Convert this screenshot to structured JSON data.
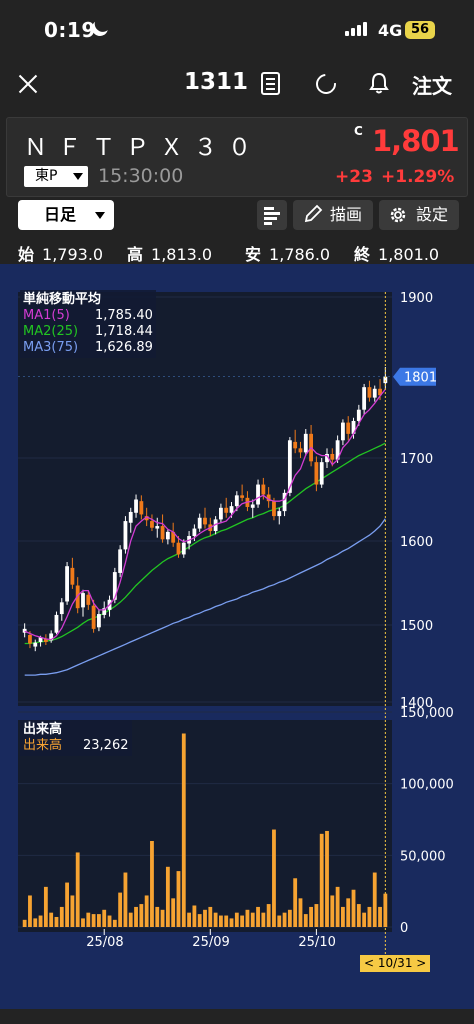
{
  "status": {
    "time": "0:19",
    "network": "4G",
    "battery": "56"
  },
  "nav": {
    "code": "1311",
    "order_label": "注文"
  },
  "stock": {
    "name": "ＮＦＴＰＸ３０",
    "market": "東P",
    "time": "15:30:00",
    "price_flag": "C",
    "price": "1,801",
    "change": "+23",
    "change_pct": "+1.29%"
  },
  "toolbar": {
    "period": "日足",
    "draw_label": "描画",
    "settings_label": "設定"
  },
  "ohlc": {
    "open_label": "始",
    "open": "1,793.0",
    "high_label": "高",
    "high": "1,813.0",
    "low_label": "安",
    "low": "1,786.0",
    "close_label": "終",
    "close": "1,801.0"
  },
  "ma_legend": {
    "title": "単純移動平均",
    "ma1_label": "MA1(5)",
    "ma1_value": "1,785.40",
    "ma2_label": "MA2(25)",
    "ma2_value": "1,718.44",
    "ma3_label": "MA3(75)",
    "ma3_value": "1,626.89"
  },
  "volume_legend": {
    "title": "出来高",
    "label": "出来高",
    "value": "23,262"
  },
  "cursor_date": "< 10/31 >",
  "colors": {
    "up": "#ffffff",
    "down": "#f07a1a",
    "ma1": "#d23cd2",
    "ma2": "#22c522",
    "ma3": "#7a9ef0",
    "volume": "#f6a332",
    "price_red": "#ff3b3b",
    "chart_bg": "#192a5e"
  },
  "chart_data": [
    {
      "type": "candlestick",
      "title": "",
      "x_ticks": [
        "25/08",
        "25/09",
        "25/10"
      ],
      "y_ticks": [
        1400,
        1500,
        1600,
        1700,
        1900
      ],
      "ylim": [
        1380,
        1910
      ],
      "last_price_label": "1801",
      "ma1_close": 1785.4,
      "ma2_close": 1718.44,
      "ma3_close": 1626.89,
      "candles": [
        [
          1490,
          1502,
          1484,
          1495
        ],
        [
          1487,
          1492,
          1470,
          1476
        ],
        [
          1472,
          1481,
          1466,
          1477
        ],
        [
          1478,
          1486,
          1472,
          1484
        ],
        [
          1482,
          1488,
          1474,
          1478
        ],
        [
          1480,
          1493,
          1477,
          1489
        ],
        [
          1490,
          1516,
          1488,
          1512
        ],
        [
          1513,
          1532,
          1505,
          1527
        ],
        [
          1528,
          1575,
          1524,
          1570
        ],
        [
          1568,
          1580,
          1543,
          1548
        ],
        [
          1547,
          1557,
          1514,
          1520
        ],
        [
          1521,
          1542,
          1510,
          1538
        ],
        [
          1536,
          1540,
          1518,
          1524
        ],
        [
          1523,
          1530,
          1490,
          1495
        ],
        [
          1497,
          1518,
          1492,
          1513
        ],
        [
          1512,
          1528,
          1508,
          1520
        ],
        [
          1518,
          1535,
          1510,
          1530
        ],
        [
          1530,
          1568,
          1526,
          1563
        ],
        [
          1562,
          1595,
          1557,
          1590
        ],
        [
          1590,
          1630,
          1585,
          1624
        ],
        [
          1622,
          1640,
          1610,
          1635
        ],
        [
          1634,
          1656,
          1628,
          1650
        ],
        [
          1648,
          1655,
          1626,
          1632
        ],
        [
          1630,
          1640,
          1618,
          1625
        ],
        [
          1624,
          1632,
          1612,
          1616
        ],
        [
          1615,
          1628,
          1604,
          1618
        ],
        [
          1618,
          1632,
          1598,
          1602
        ],
        [
          1602,
          1614,
          1596,
          1611
        ],
        [
          1611,
          1622,
          1593,
          1598
        ],
        [
          1598,
          1606,
          1580,
          1584
        ],
        [
          1584,
          1602,
          1580,
          1598
        ],
        [
          1597,
          1612,
          1590,
          1606
        ],
        [
          1606,
          1620,
          1600,
          1615
        ],
        [
          1615,
          1633,
          1611,
          1628
        ],
        [
          1628,
          1640,
          1615,
          1620
        ],
        [
          1620,
          1628,
          1606,
          1612
        ],
        [
          1612,
          1630,
          1608,
          1626
        ],
        [
          1626,
          1645,
          1622,
          1640
        ],
        [
          1640,
          1652,
          1628,
          1634
        ],
        [
          1634,
          1647,
          1628,
          1642
        ],
        [
          1642,
          1660,
          1636,
          1655
        ],
        [
          1655,
          1668,
          1648,
          1652
        ],
        [
          1652,
          1660,
          1636,
          1641
        ],
        [
          1640,
          1650,
          1628,
          1644
        ],
        [
          1644,
          1674,
          1640,
          1668
        ],
        [
          1668,
          1676,
          1650,
          1656
        ],
        [
          1656,
          1665,
          1640,
          1648
        ],
        [
          1648,
          1652,
          1625,
          1630
        ],
        [
          1630,
          1640,
          1620,
          1636
        ],
        [
          1636,
          1662,
          1630,
          1658
        ],
        [
          1658,
          1726,
          1654,
          1722
        ],
        [
          1720,
          1735,
          1706,
          1712
        ],
        [
          1712,
          1720,
          1700,
          1707
        ],
        [
          1707,
          1736,
          1703,
          1730
        ],
        [
          1730,
          1741,
          1690,
          1696
        ],
        [
          1695,
          1702,
          1660,
          1668
        ],
        [
          1668,
          1700,
          1664,
          1695
        ],
        [
          1695,
          1712,
          1688,
          1705
        ],
        [
          1705,
          1712,
          1690,
          1698
        ],
        [
          1698,
          1728,
          1694,
          1722
        ],
        [
          1722,
          1748,
          1716,
          1744
        ],
        [
          1744,
          1752,
          1722,
          1730
        ],
        [
          1730,
          1750,
          1724,
          1746
        ],
        [
          1746,
          1766,
          1740,
          1760
        ],
        [
          1760,
          1792,
          1754,
          1788
        ],
        [
          1788,
          1796,
          1770,
          1775
        ],
        [
          1775,
          1790,
          1770,
          1786
        ],
        [
          1786,
          1798,
          1772,
          1778
        ],
        [
          1793,
          1813,
          1786,
          1801
        ]
      ],
      "ma1": [
        1492,
        1489,
        1486,
        1484,
        1482,
        1481,
        1486,
        1496,
        1510,
        1525,
        1535,
        1541,
        1541,
        1526,
        1518,
        1518,
        1524,
        1532,
        1551,
        1574,
        1600,
        1618,
        1624,
        1629,
        1626,
        1622,
        1621,
        1614,
        1611,
        1603,
        1599,
        1601,
        1604,
        1609,
        1613,
        1616,
        1620,
        1622,
        1624,
        1631,
        1639,
        1645,
        1647,
        1648,
        1652,
        1655,
        1650,
        1648,
        1648,
        1650,
        1665,
        1679,
        1687,
        1704,
        1713,
        1706,
        1703,
        1703,
        1692,
        1698,
        1713,
        1720,
        1730,
        1743,
        1754,
        1760,
        1768,
        1777,
        1785.4
      ],
      "ma2": [
        1476,
        1476,
        1477,
        1478,
        1479,
        1480,
        1482,
        1485,
        1489,
        1493,
        1497,
        1502,
        1506,
        1508,
        1511,
        1514,
        1518,
        1522,
        1527,
        1533,
        1540,
        1547,
        1553,
        1559,
        1565,
        1570,
        1575,
        1579,
        1582,
        1585,
        1589,
        1593,
        1597,
        1601,
        1604,
        1606,
        1609,
        1612,
        1614,
        1617,
        1620,
        1623,
        1626,
        1628,
        1631,
        1633,
        1636,
        1638,
        1640,
        1643,
        1648,
        1653,
        1658,
        1663,
        1667,
        1671,
        1675,
        1679,
        1683,
        1687,
        1691,
        1695,
        1699,
        1703,
        1706,
        1709,
        1712,
        1715,
        1718.44
      ],
      "ma3": [
        1435,
        1435,
        1435,
        1436,
        1436,
        1437,
        1438,
        1440,
        1442,
        1445,
        1448,
        1451,
        1454,
        1457,
        1460,
        1463,
        1466,
        1469,
        1472,
        1475,
        1478,
        1481,
        1484,
        1487,
        1490,
        1493,
        1496,
        1499,
        1502,
        1504,
        1507,
        1509,
        1512,
        1514,
        1517,
        1519,
        1522,
        1524,
        1527,
        1529,
        1531,
        1534,
        1536,
        1539,
        1541,
        1543,
        1546,
        1548,
        1551,
        1553,
        1556,
        1559,
        1562,
        1565,
        1568,
        1571,
        1574,
        1578,
        1581,
        1584,
        1588,
        1591,
        1595,
        1599,
        1603,
        1607,
        1612,
        1618,
        1626.89
      ]
    },
    {
      "type": "bar",
      "title": "出来高",
      "y_ticks": [
        0,
        50000,
        100000,
        150000
      ],
      "ylim": [
        0,
        150000
      ],
      "values": [
        5000,
        22000,
        6000,
        8000,
        28000,
        10000,
        7000,
        14000,
        31000,
        22000,
        52000,
        6000,
        10000,
        9000,
        9000,
        12000,
        8000,
        5000,
        24000,
        38000,
        10000,
        14000,
        16000,
        22000,
        60000,
        14000,
        12000,
        42000,
        20000,
        39000,
        135000,
        10000,
        15000,
        9000,
        12000,
        14000,
        10000,
        8000,
        8000,
        6000,
        10000,
        8000,
        12000,
        10000,
        14000,
        10000,
        16000,
        68000,
        8000,
        10000,
        12000,
        34000,
        20000,
        9000,
        14000,
        16000,
        65000,
        67000,
        22000,
        28000,
        14000,
        20000,
        26000,
        16000,
        10000,
        14000,
        38000,
        14000,
        23262
      ]
    }
  ]
}
